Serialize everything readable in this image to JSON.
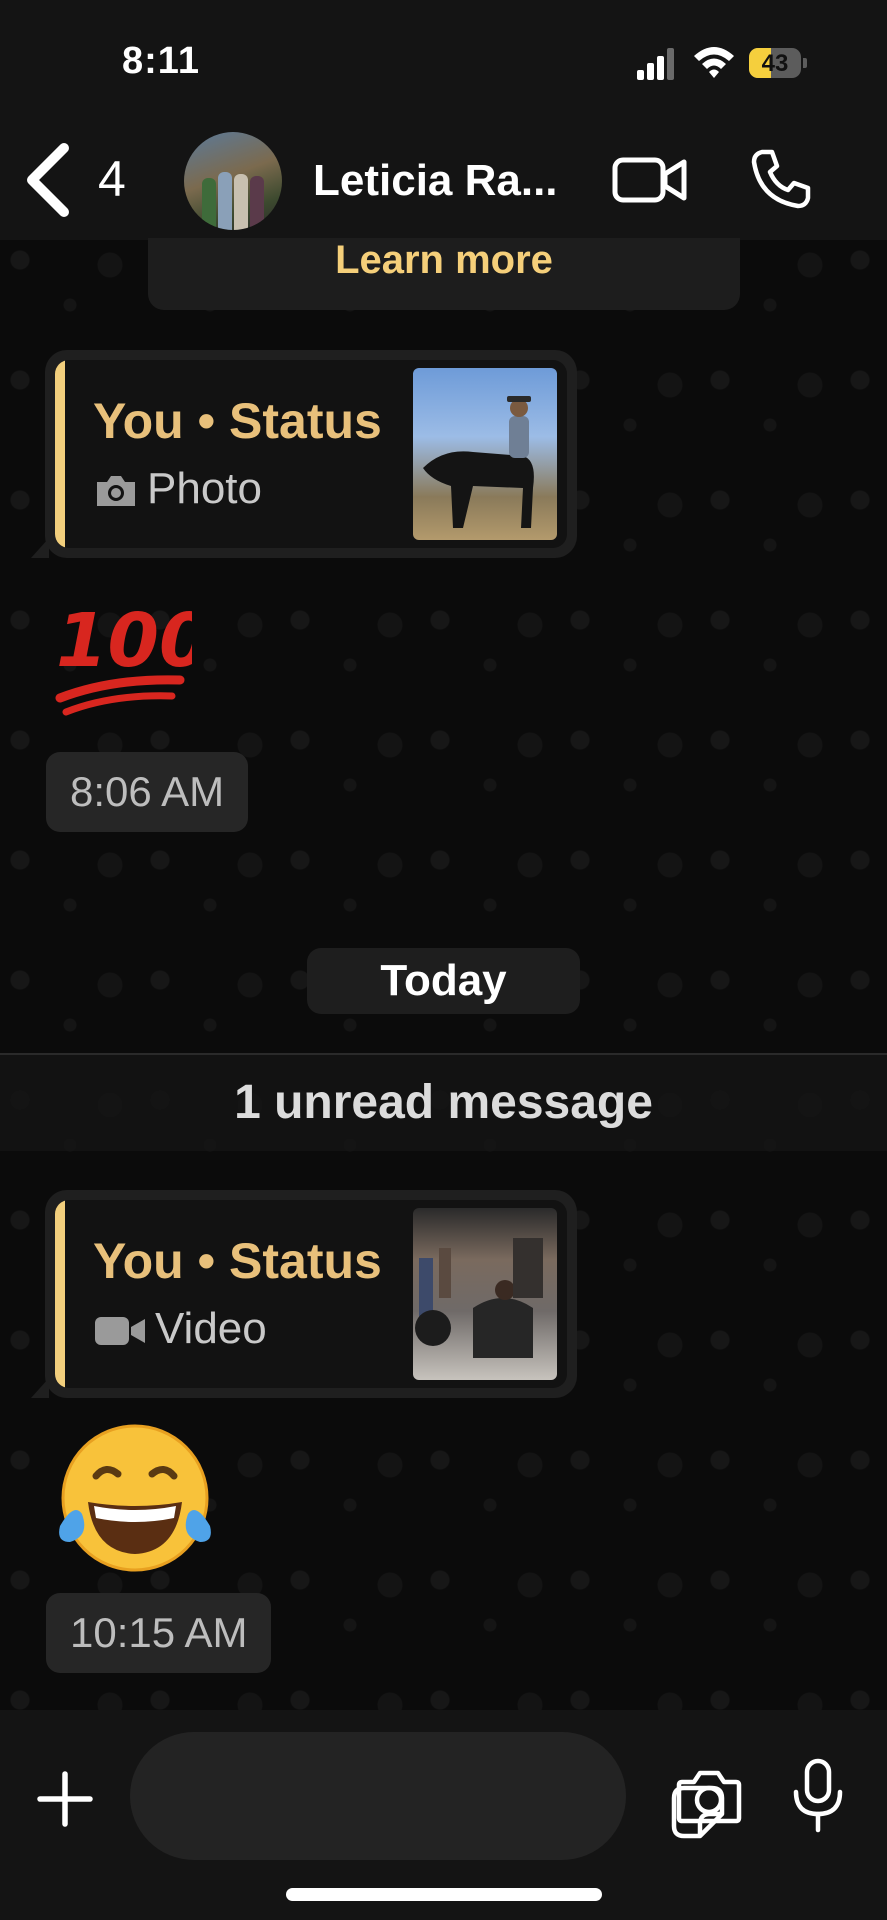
{
  "status_bar": {
    "time": "8:11",
    "battery": "43",
    "battery_level": 0.43,
    "signal_icon": "cell-signal-icon",
    "wifi_icon": "wifi-icon"
  },
  "header": {
    "back_count": "4",
    "contact_name": "Leticia Ra...",
    "icons": [
      "chevron-left-icon",
      "video-camera-icon",
      "phone-icon"
    ]
  },
  "banner": {
    "link_text": "Learn more"
  },
  "messages": [
    {
      "type": "status-reply",
      "title": "You • Status",
      "media_type": "Photo",
      "media_icon": "camera-icon",
      "emoji": "💯",
      "time": "8:06 AM"
    },
    {
      "type": "status-reply",
      "title": "You • Status",
      "media_type": "Video",
      "media_icon": "video-camera-icon",
      "emoji": "😂",
      "time": "10:15 AM"
    }
  ],
  "date_chip": "Today",
  "unread_separator": "1 unread message",
  "input_bar": {
    "placeholder": "",
    "icons": [
      "plus-icon",
      "sticker-icon",
      "camera-icon",
      "microphone-icon"
    ]
  },
  "colors": {
    "accent_gold": "#f5cf7a",
    "quote_bar": "#f2cf7d",
    "background": "#0d0d0d"
  }
}
